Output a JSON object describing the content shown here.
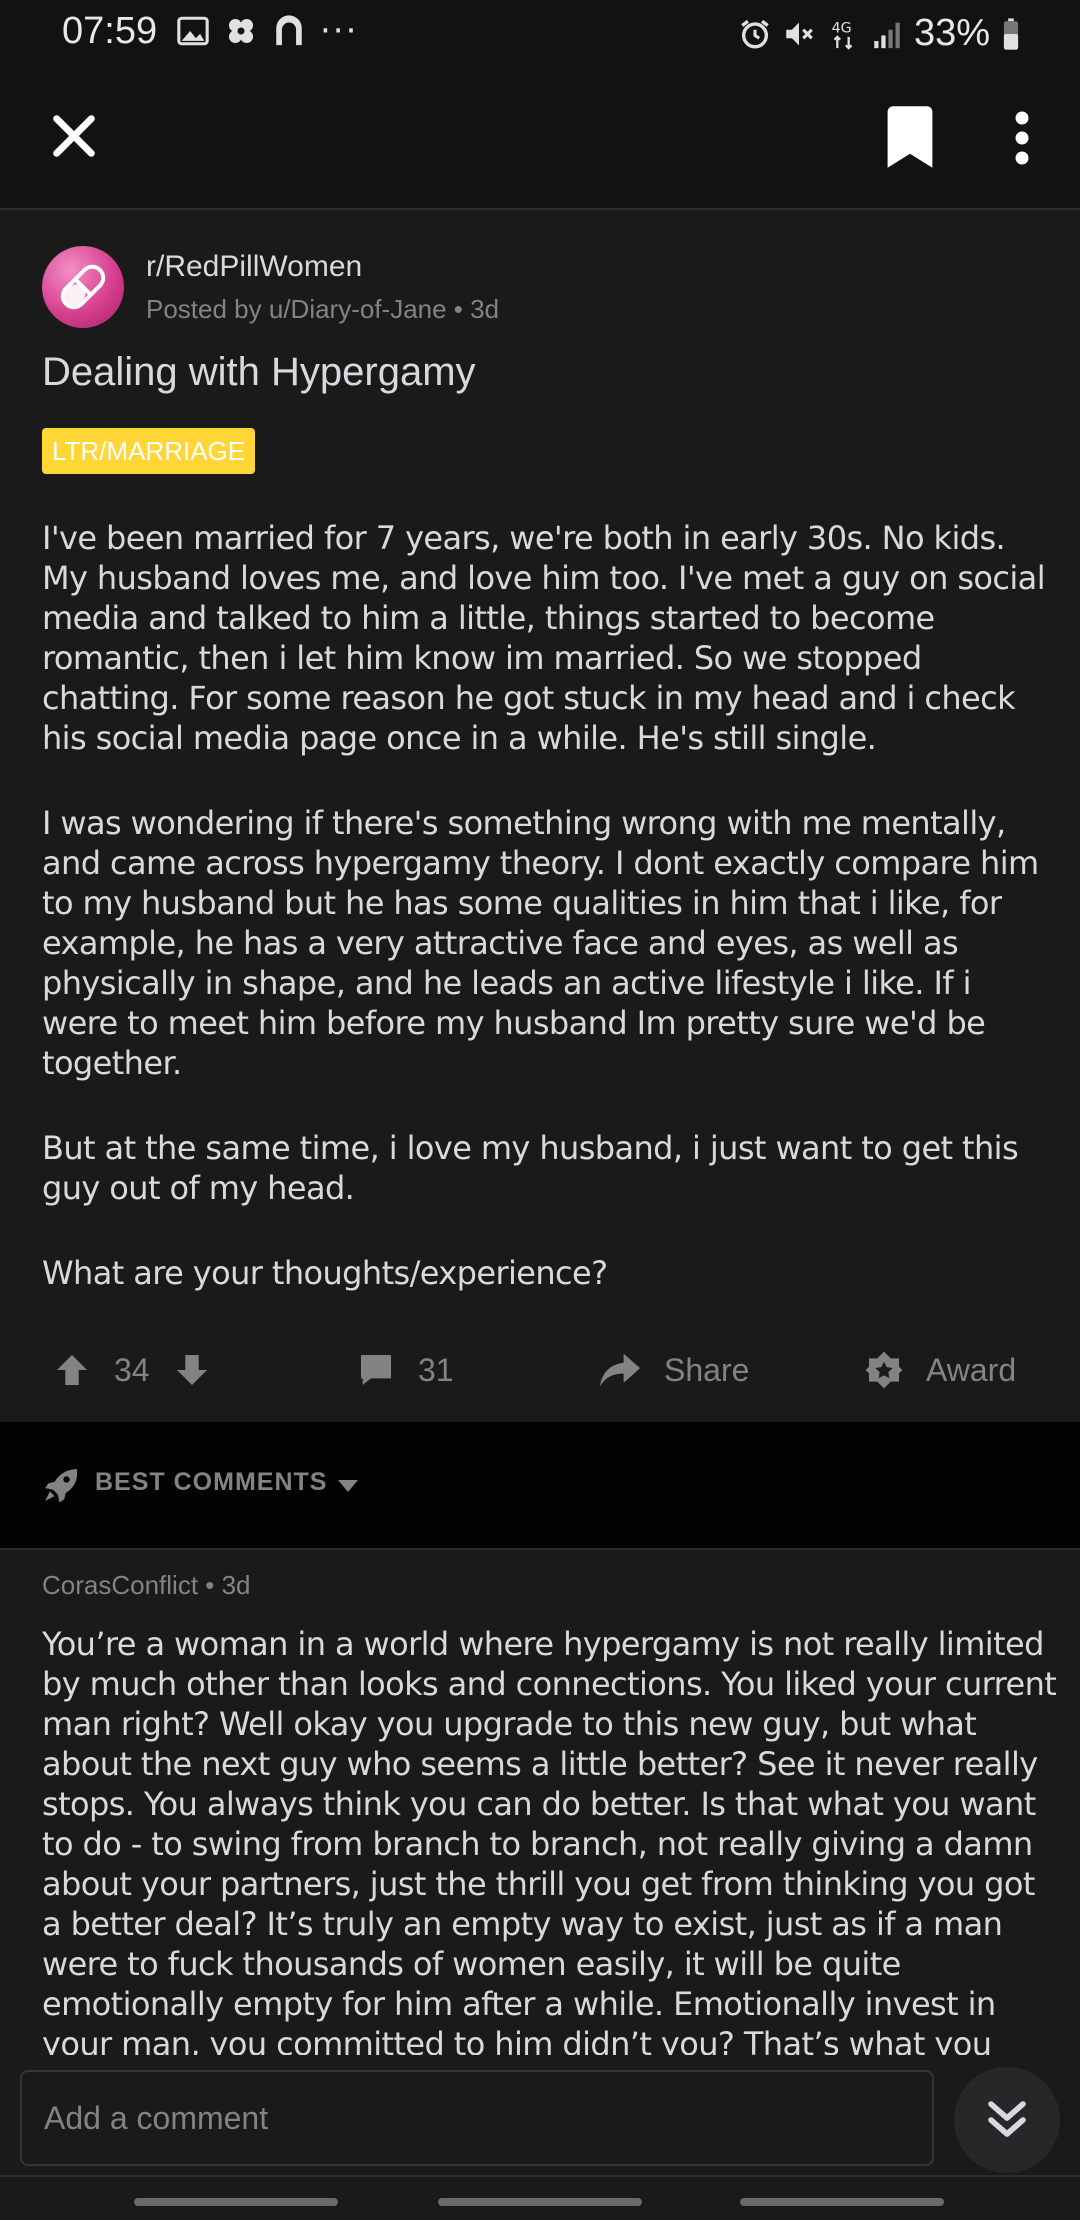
{
  "status_bar": {
    "time": "07:59",
    "left_icons": [
      "image-icon",
      "flower-icon",
      "arch-icon"
    ],
    "more": "···",
    "right_icons": [
      "alarm-icon",
      "mute-icon",
      "network-4g-icon",
      "signal-icon"
    ],
    "battery_percent": "33%"
  },
  "top_bar": {
    "close_icon": "close-icon",
    "bookmark_icon": "bookmark-icon",
    "more_icon": "more-vertical-icon"
  },
  "post": {
    "subreddit": "r/RedPillWomen",
    "meta": "Posted by u/Diary-of-Jane • 3d",
    "title": "Dealing with Hypergamy",
    "flair": "LTR/MARRIAGE",
    "flair_color": "#ffd635",
    "paragraphs": [
      "I've been married for 7 years, we're both in early 30s. No kids. My husband loves me, and love him too. I've met a guy on social media and talked to him a little, things started to become romantic, then i let him know im married. So we stopped chatting. For some reason he got stuck in my head and i check his social media page once in a while. He's still single.",
      "I was wondering if there's something wrong with me mentally, and came across hypergamy theory. I dont exactly compare him to my husband but he has some qualities in him that i like, for example, he has a very attractive face and eyes, as well as physically in shape, and he leads an active lifestyle i like. If i were to meet him before my husband Im pretty sure we'd be together.",
      "But at the same time, i love my husband, i just want to get this guy out of my head.",
      "What are your thoughts/experience?"
    ],
    "actions": {
      "score": "34",
      "comments": "31",
      "share": "Share",
      "award": "Award"
    }
  },
  "sort": {
    "label": "BEST COMMENTS"
  },
  "comment": {
    "meta": "CorasConflict • 3d",
    "body": "You’re a woman in a world where hypergamy is not really limited by much other than looks and connections. You liked your current man right? Well okay you upgrade to this new guy, but what about the next guy who seems a little better? See it never really stops. You always think you can do better. Is that what you want to do - to swing from branch to branch, not really giving a damn about your partners, just the thrill you get from thinking you got a better deal? It’s truly an empty way to exist, just as if a man were to fuck thousands of women easily, it will be quite emotionally empty for him after a while. Emotionally invest in your man, you committed to him didn’t you? That’s what you"
  },
  "composer": {
    "placeholder": "Add a comment"
  },
  "colors": {
    "background": "#1a1a1b",
    "bar": "#121212",
    "muted_text": "#818384",
    "body_text": "#d7dadc",
    "subreddit_accent": "#d6408f"
  }
}
